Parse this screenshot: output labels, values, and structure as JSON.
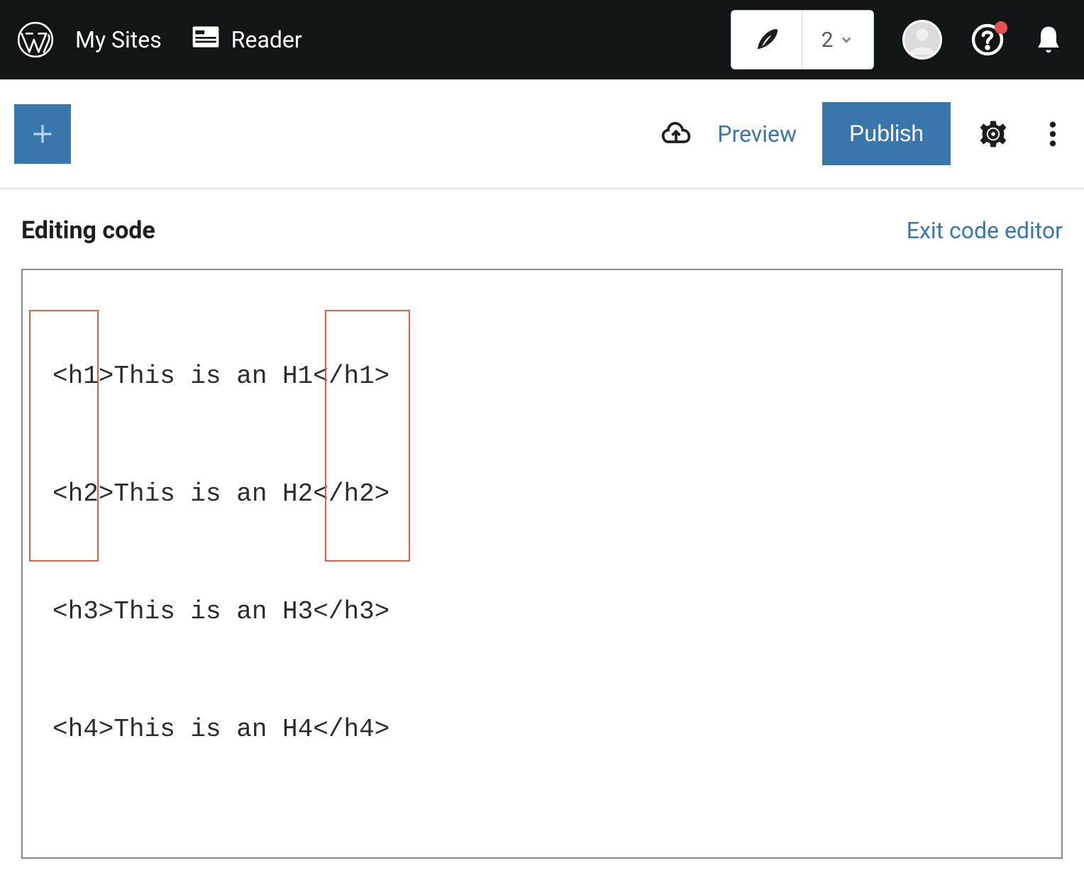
{
  "masterbar": {
    "my_sites_label": "My Sites",
    "reader_label": "Reader",
    "write_count": "2"
  },
  "toolbar": {
    "preview_label": "Preview",
    "publish_label": "Publish"
  },
  "editor": {
    "heading": "Editing code",
    "exit_label": "Exit code editor",
    "code_lines": [
      "<h1>This is an H1</h1>",
      "<h2>This is an H2</h2>",
      "<h3>This is an H3</h3>",
      "<h4>This is an H4</h4>"
    ]
  }
}
